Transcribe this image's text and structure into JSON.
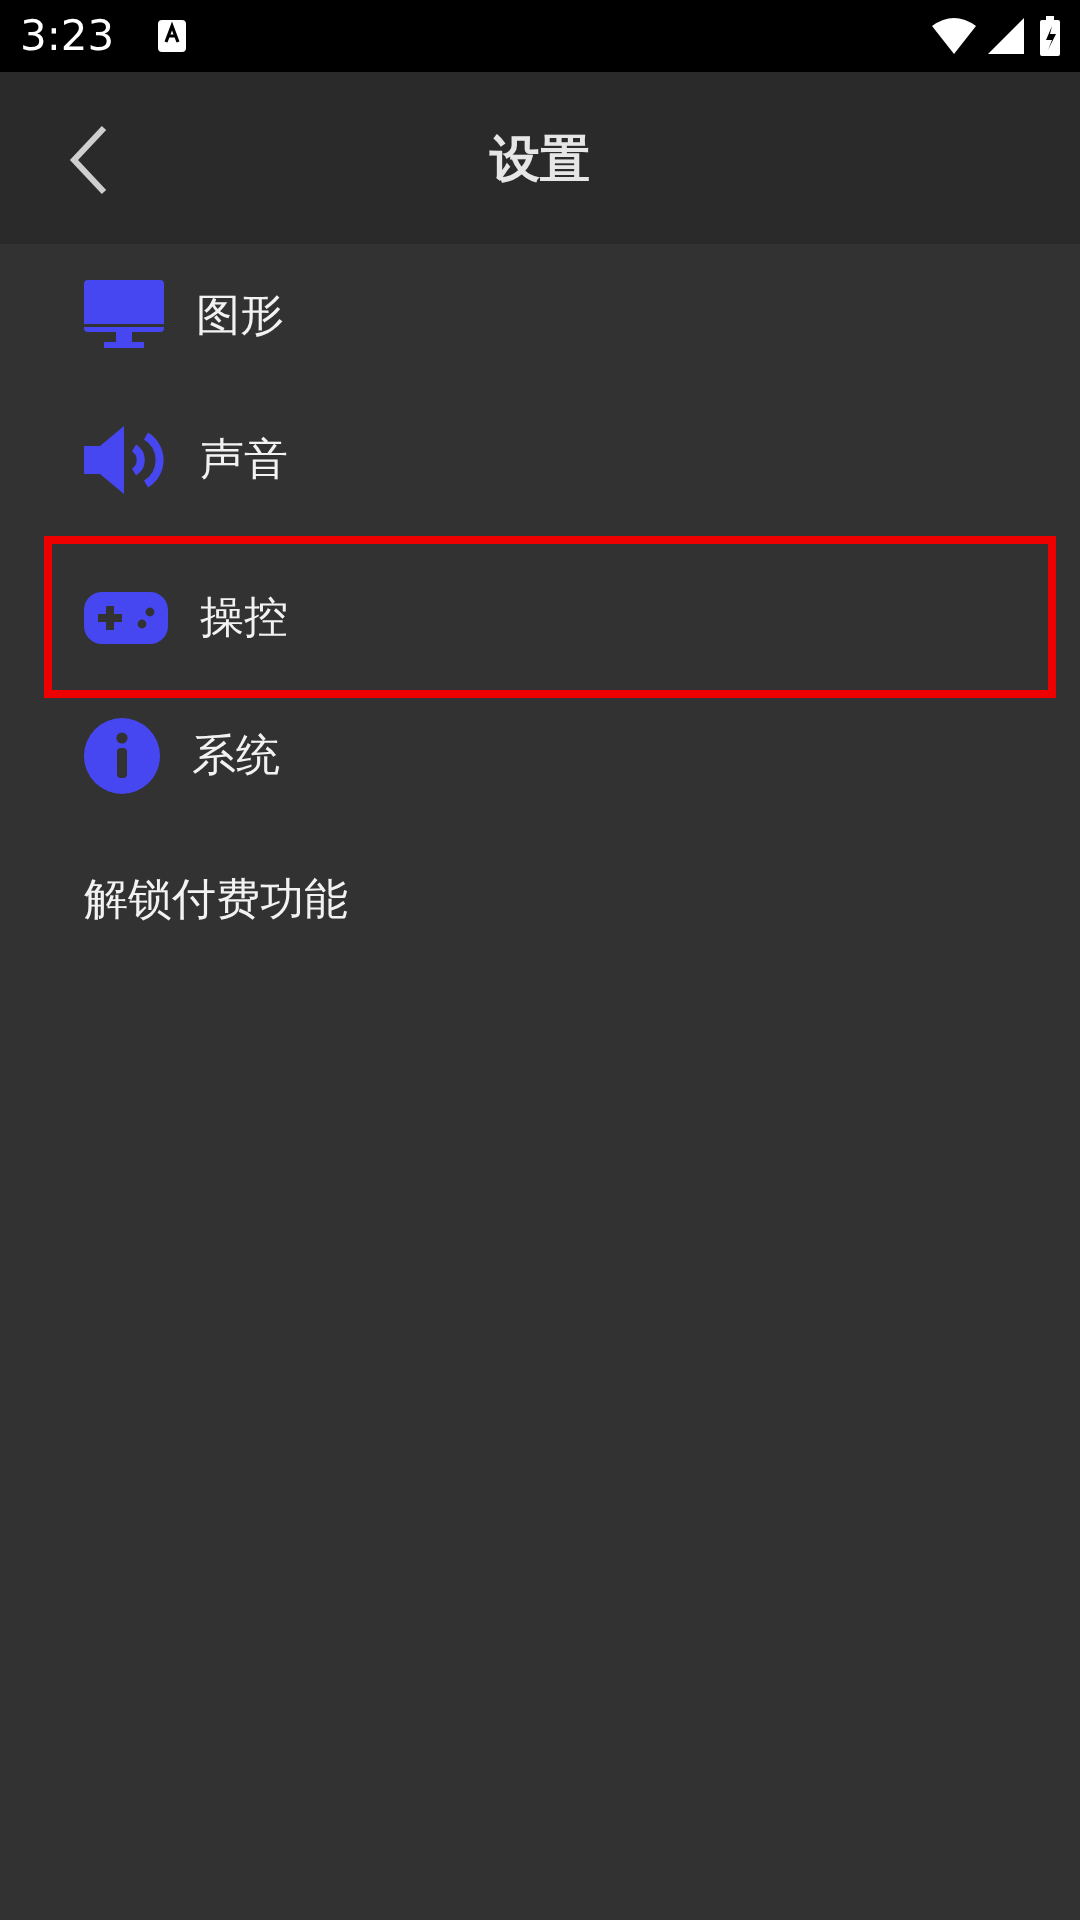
{
  "status_bar": {
    "time": "3:23"
  },
  "header": {
    "title": "设置"
  },
  "menu": [
    {
      "kind": "graphics",
      "label": "图形",
      "highlighted": false
    },
    {
      "kind": "sound",
      "label": "声音",
      "highlighted": false
    },
    {
      "kind": "controls",
      "label": "操控",
      "highlighted": true
    },
    {
      "kind": "system",
      "label": "系统",
      "highlighted": false
    },
    {
      "kind": "plain",
      "label": "解锁付费功能",
      "highlighted": false
    }
  ]
}
